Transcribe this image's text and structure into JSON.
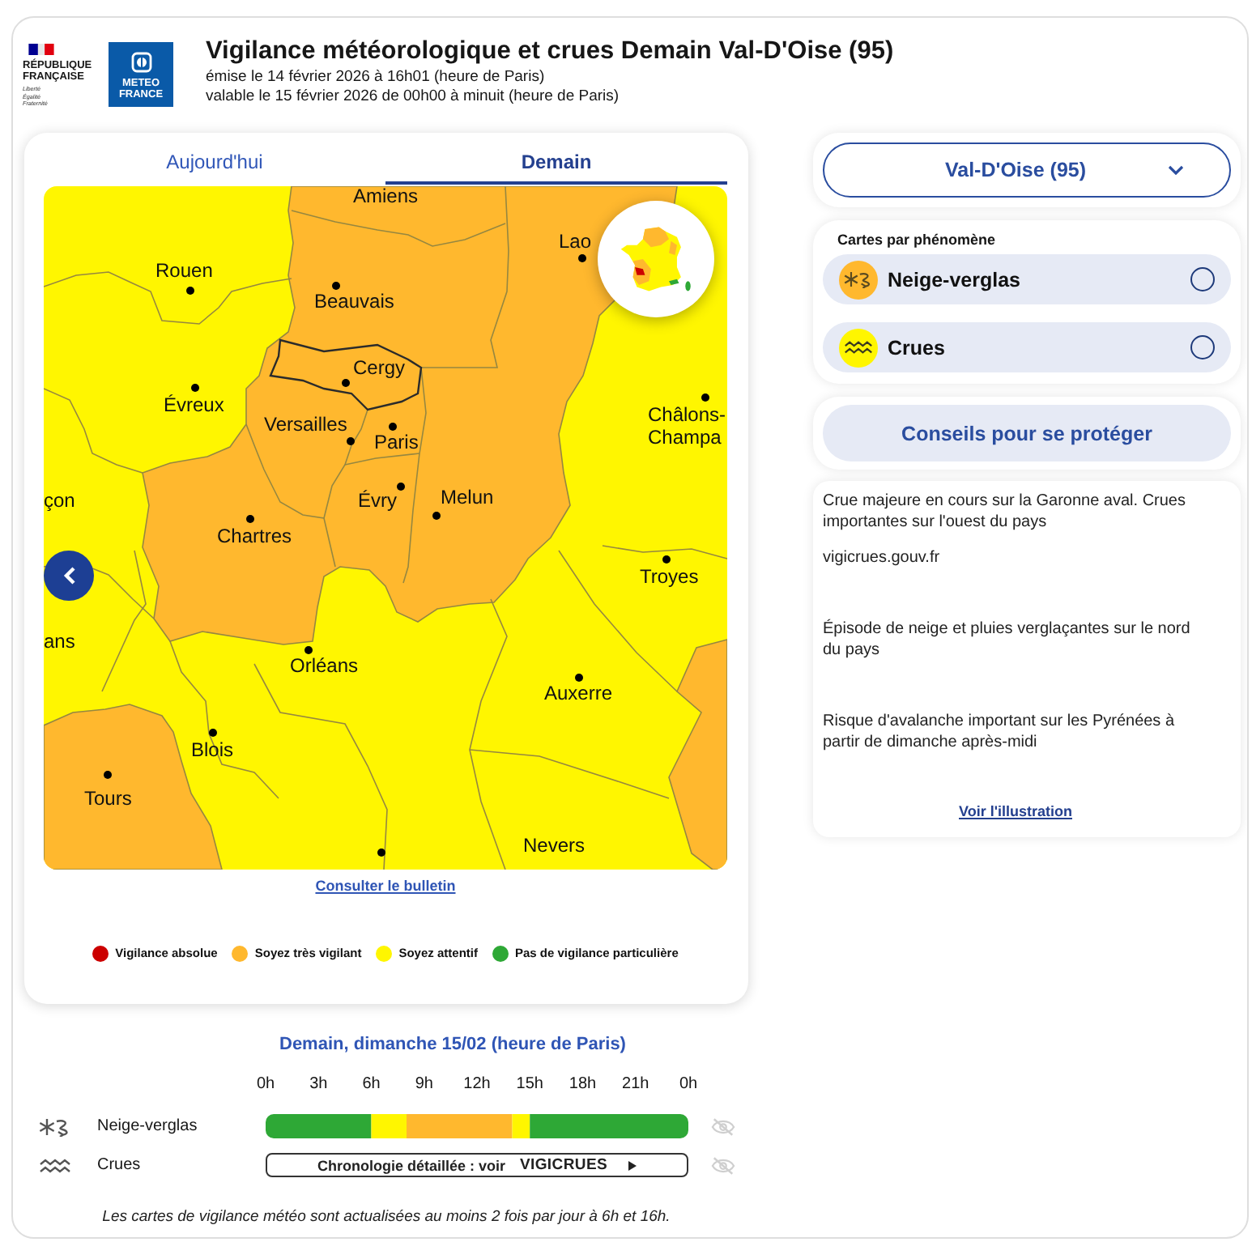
{
  "header": {
    "republic_logo": {
      "name": "RÉPUBLIQUE FRANÇAISE",
      "motto": "Liberté Égalité Fraternité"
    },
    "meteo_logo": {
      "name": "METEO FRANCE"
    },
    "title": "Vigilance météorologique et crues Demain Val-D'Oise (95)",
    "issued": "émise le 14 février 2026 à 16h01 (heure de Paris)",
    "valid": "valable le 15 février 2026 de 00h00 à minuit (heure de Paris)"
  },
  "map_card": {
    "tabs": [
      {
        "label": "Aujourd'hui",
        "selected": false
      },
      {
        "label": "Demain",
        "selected": true
      }
    ],
    "cities": [
      {
        "name": "Amiens"
      },
      {
        "name": "Lao"
      },
      {
        "name": "Rouen"
      },
      {
        "name": "Beauvais"
      },
      {
        "name": "Cergy"
      },
      {
        "name": "Évreux"
      },
      {
        "name": "Versailles"
      },
      {
        "name": "Paris"
      },
      {
        "name": "Châlons-Champa"
      },
      {
        "name": "çon"
      },
      {
        "name": "Évry"
      },
      {
        "name": "Melun"
      },
      {
        "name": "Chartres"
      },
      {
        "name": "Troyes"
      },
      {
        "name": "ans"
      },
      {
        "name": "Orléans"
      },
      {
        "name": "Auxerre"
      },
      {
        "name": "Blois"
      },
      {
        "name": "Tours"
      },
      {
        "name": "Nevers"
      }
    ],
    "bulletin_link": "Consulter le bulletin",
    "legend": [
      {
        "label": "Vigilance absolue",
        "color": "#cc0000"
      },
      {
        "label": "Soyez très vigilant",
        "color": "#ffb82e"
      },
      {
        "label": "Soyez attentif",
        "color": "#fff600"
      },
      {
        "label": "Pas de vigilance particulière",
        "color": "#2ea836"
      }
    ]
  },
  "right_panel": {
    "department_select": {
      "value": "Val-D'Oise (95)"
    },
    "phenomena": {
      "title": "Cartes par phénomène",
      "items": [
        {
          "kind": "snow-ice",
          "label": "Neige-verglas",
          "color": "#ffb82e",
          "selected": false
        },
        {
          "kind": "flood",
          "label": "Crues",
          "color": "#fff600",
          "selected": false
        }
      ]
    },
    "advice_button": "Conseils pour se protéger",
    "messages": {
      "groups": [
        [
          "Crue majeure en cours sur la Garonne aval. Crues importantes sur l'ouest du pays",
          "vigicrues.gouv.fr"
        ],
        [
          "Épisode de neige et pluies verglaçantes sur le nord du pays"
        ],
        [
          "Risque d'avalanche important sur les Pyrénées à partir de dimanche après-midi"
        ]
      ],
      "link": "Voir l'illustration"
    }
  },
  "timeline": {
    "title": "Demain, dimanche 15/02 (heure de Paris)",
    "rows": [
      {
        "kind": "snow-ice",
        "chart_data": {
          "type": "bar",
          "orientation": "horizontal",
          "stacked": true,
          "categories": [
            "Neige-verglas"
          ],
          "xlim": [
            0,
            24
          ],
          "xticks": [
            {
              "value": 0,
              "label": "0h"
            },
            {
              "value": 3,
              "label": "3h"
            },
            {
              "value": 6,
              "label": "6h"
            },
            {
              "value": 9,
              "label": "9h"
            },
            {
              "value": 12,
              "label": "12h"
            },
            {
              "value": 15,
              "label": "15h"
            },
            {
              "value": 18,
              "label": "18h"
            },
            {
              "value": 21,
              "label": "21h"
            }
          ],
          "series": [
            {
              "color": "#2ea836",
              "values": [
                6
              ]
            },
            {
              "color": "#fff600",
              "values": [
                2
              ]
            },
            {
              "color": "#ffb82e",
              "values": [
                6
              ]
            },
            {
              "color": "#fff600",
              "values": [
                1
              ]
            },
            {
              "color": "#2ea836",
              "values": [
                9
              ]
            }
          ]
        },
        "midnight_label": "0h"
      },
      {
        "kind": "flood",
        "label": "Crues",
        "link": {
          "text": "Chronologie détaillée : voir",
          "brand": "VIGICRUES"
        }
      }
    ],
    "footnote": "Les cartes de vigilance météo sont actualisées au moins 2 fois par jour à 6h et 16h."
  }
}
